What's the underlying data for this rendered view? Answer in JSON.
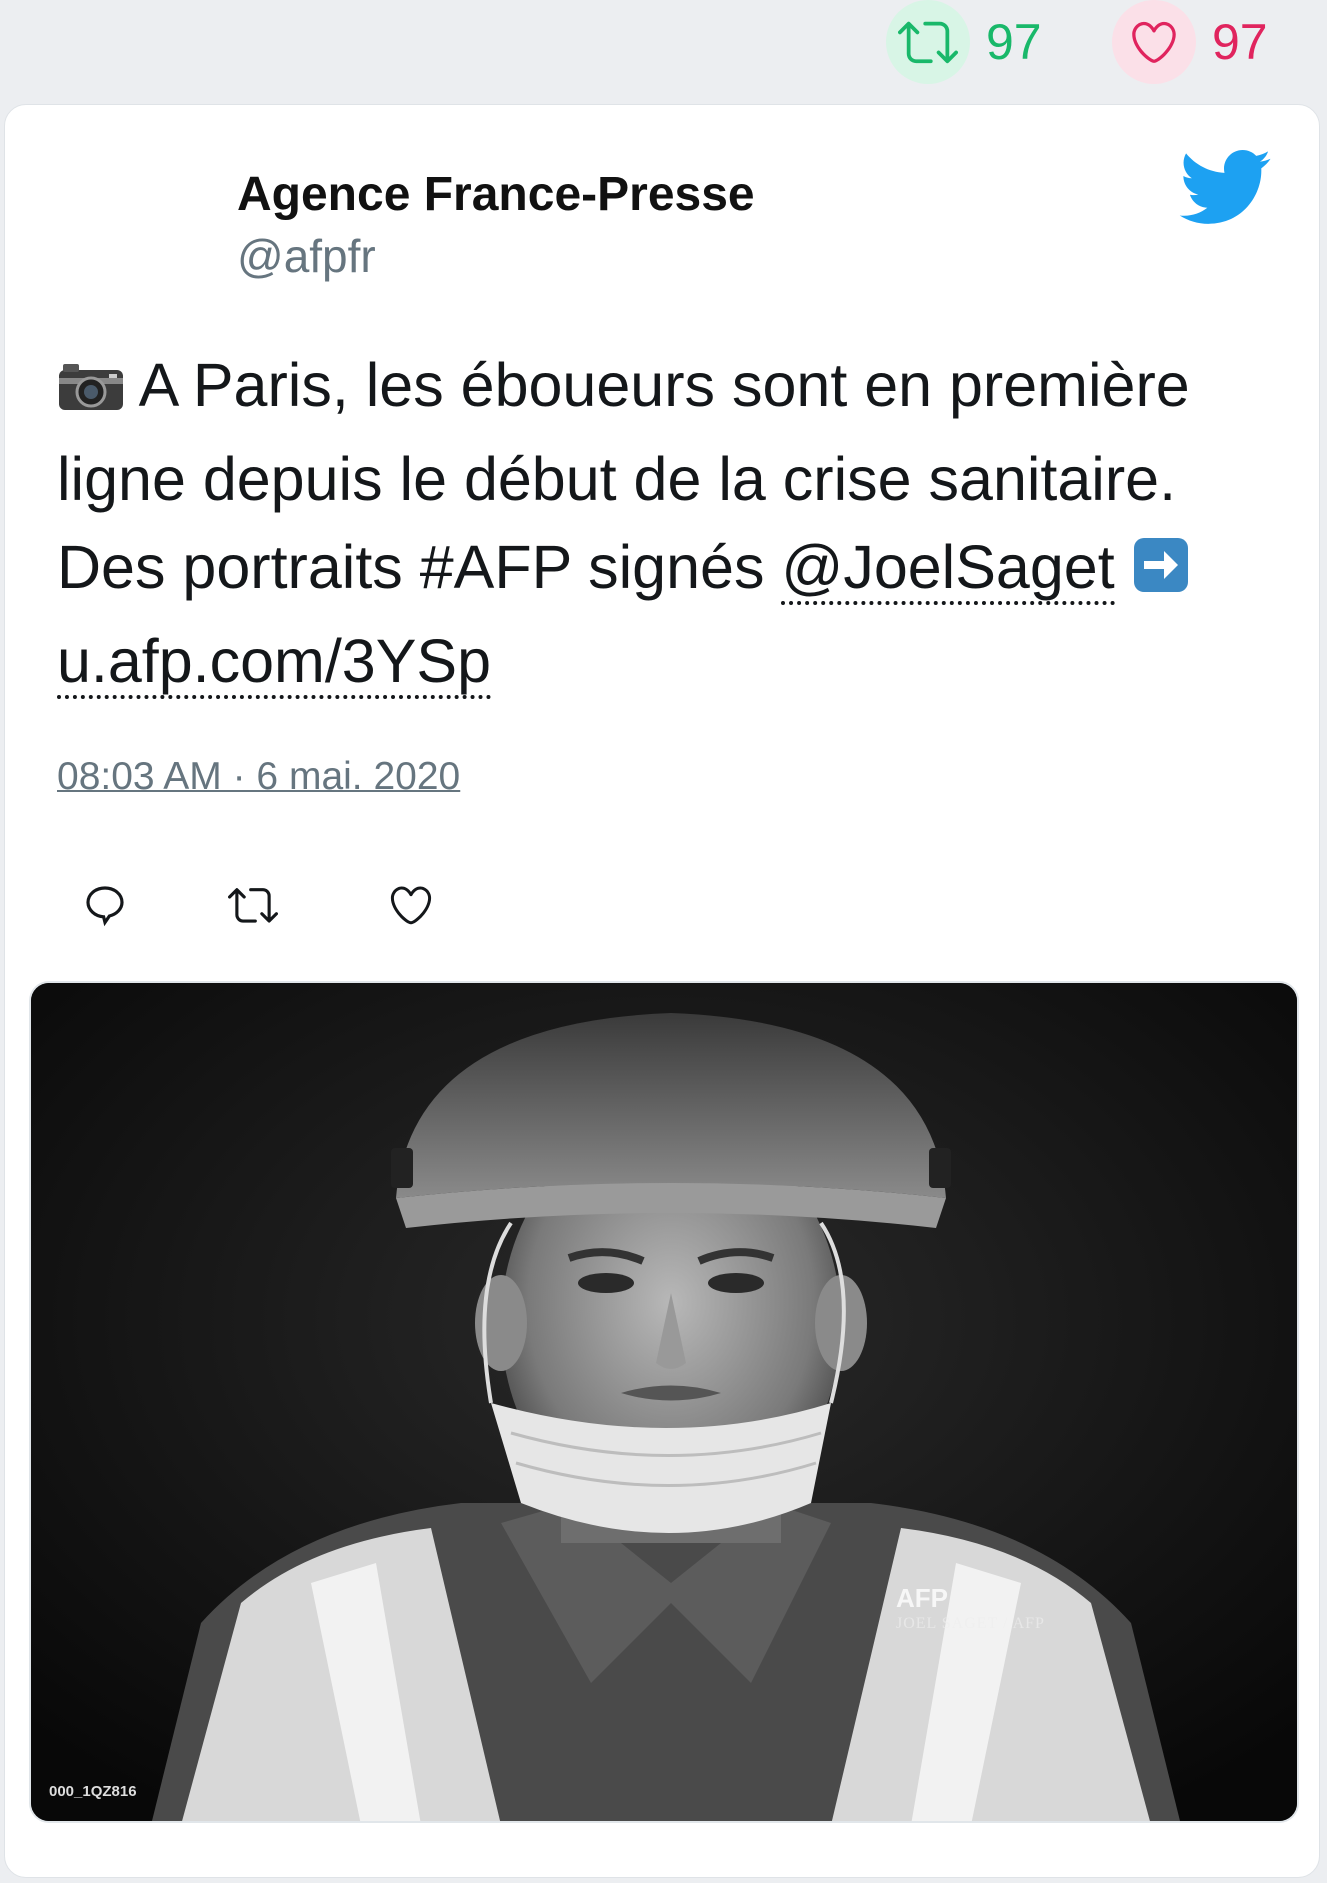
{
  "stats": {
    "retweet_count": "97",
    "like_count": "97",
    "retweet_color": "#19b86a",
    "like_color": "#e0245e"
  },
  "tweet": {
    "author_name": "Agence France-Presse",
    "author_handle": "@afpfr",
    "text_part1": " A Paris, les éboueurs sont en première ligne depuis le début de la crise sanitaire. Des portraits #AFP signés ",
    "mention": "@JoelSaget",
    "link": "u.afp.com/3YSp",
    "timestamp": "08:03 AM · 6 mai. 2020",
    "leading_emoji": "camera-icon",
    "arrow_emoji": "right-arrow-icon"
  },
  "photo": {
    "watermark_logo": "AFP",
    "watermark_credit": "JOEL SAGET / AFP",
    "photo_id": "000_1QZ816"
  },
  "actions": [
    "reply-icon",
    "retweet-icon",
    "like-icon"
  ],
  "brand": {
    "twitter_blue": "#1da1f2"
  }
}
